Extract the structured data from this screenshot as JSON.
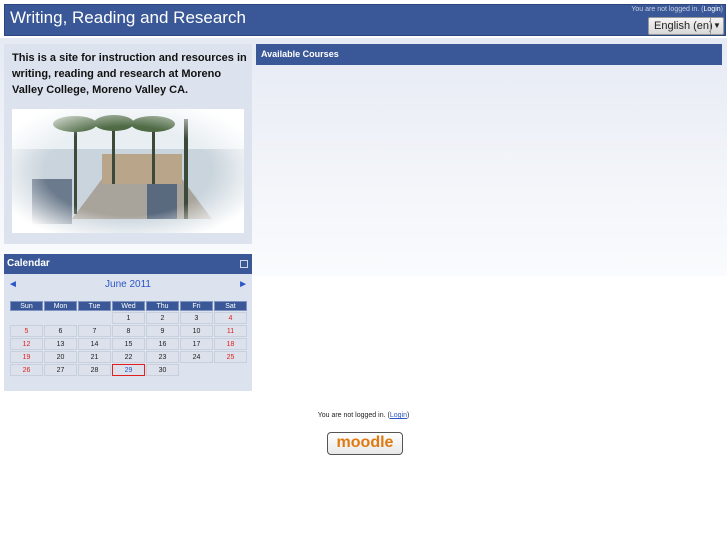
{
  "header": {
    "title": "Writing, Reading and Research",
    "not_logged_in": "You are not logged in. (",
    "login": "Login",
    "close_paren": ")",
    "language": "English (en)"
  },
  "summary": {
    "text": "This is a site for instruction and resources in writing, reading and research at Moreno Valley College, Moreno Valley CA."
  },
  "courses": {
    "title": "Available Courses"
  },
  "calendar": {
    "title": "Calendar",
    "month": "June 2011",
    "prev": "◄",
    "next": "►",
    "days": [
      "Sun",
      "Mon",
      "Tue",
      "Wed",
      "Thu",
      "Fri",
      "Sat"
    ],
    "weeks": [
      [
        "",
        "",
        "",
        "1",
        "2",
        "3",
        "4"
      ],
      [
        "5",
        "6",
        "7",
        "8",
        "9",
        "10",
        "11"
      ],
      [
        "12",
        "13",
        "14",
        "15",
        "16",
        "17",
        "18"
      ],
      [
        "19",
        "20",
        "21",
        "22",
        "23",
        "24",
        "25"
      ],
      [
        "26",
        "27",
        "28",
        "29",
        "30",
        "",
        ""
      ]
    ],
    "today": "29"
  },
  "footer": {
    "text": "You are not logged in. (",
    "login": "Login",
    "close": ")",
    "logo": "moodle"
  }
}
